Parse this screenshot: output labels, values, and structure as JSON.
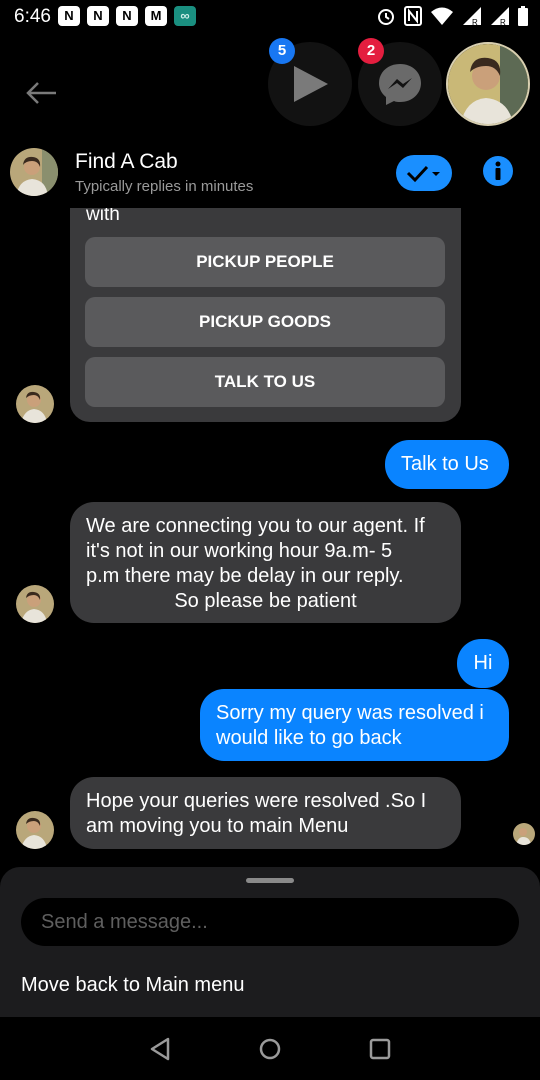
{
  "status_bar": {
    "time": "6:46",
    "notifications": [
      "N",
      "N",
      "N",
      "M",
      "∞"
    ],
    "system": [
      "alarm-icon",
      "nfc-icon",
      "wifi-icon",
      "signal-icon",
      "signal-icon",
      "battery-icon"
    ],
    "signal_labels": [
      "R",
      "R"
    ]
  },
  "chat_heads": {
    "video_badge": "5",
    "messenger_badge": "2"
  },
  "header": {
    "name": "Find A Cab",
    "subtitle": "Typically replies in minutes"
  },
  "card": {
    "text": "with",
    "buttons": [
      "PICKUP PEOPLE",
      "PICKUP GOODS",
      "TALK TO US"
    ]
  },
  "messages": [
    {
      "from": "me",
      "text": "Talk to Us"
    },
    {
      "from": "bot",
      "lines": [
        "We are connecting you to our agent. If",
        "it's not in our working hour 9a.m- 5",
        "p.m there may be delay in our reply."
      ],
      "last_line": "So please be patient"
    },
    {
      "from": "me",
      "text": "Hi"
    },
    {
      "from": "me",
      "lines": [
        "Sorry my query was resolved i",
        "would like to go back"
      ]
    },
    {
      "from": "bot",
      "lines": [
        "Hope your queries were resolved .So I",
        "am moving you to main Menu"
      ]
    }
  ],
  "composer": {
    "placeholder": "Send a message...",
    "menu_item": "Move back to Main menu"
  },
  "colors": {
    "accent": "#0a84ff",
    "bubble_in": "#3a3a3c",
    "sheet": "#1c1c1e",
    "badge_red": "#e41e3f"
  }
}
